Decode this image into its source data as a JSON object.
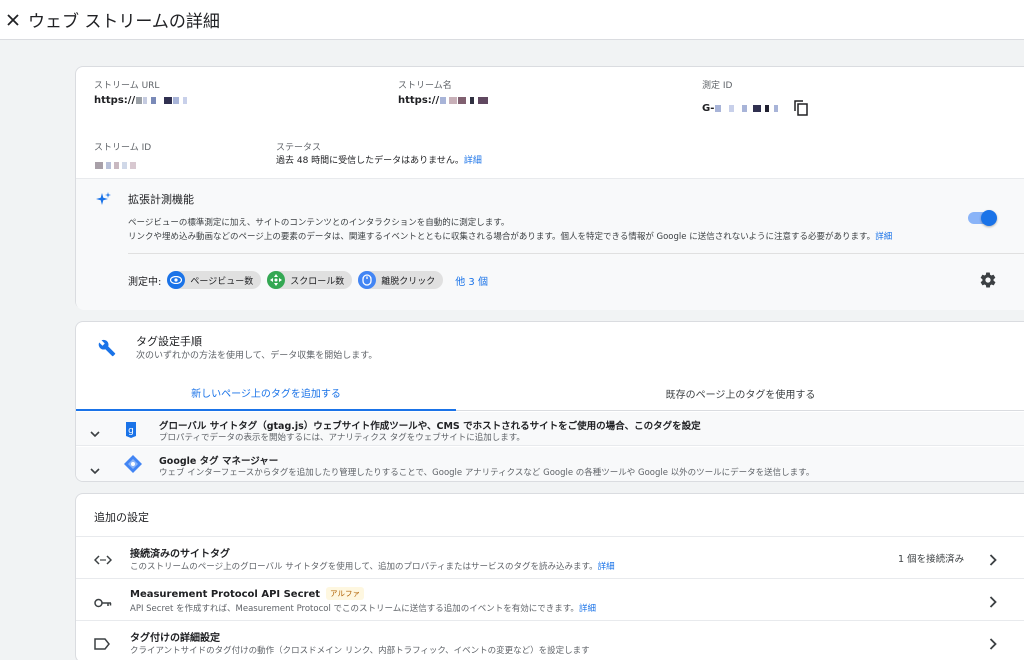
{
  "header": {
    "title": "ウェブ ストリームの詳細",
    "close_icon": "close-icon"
  },
  "stream": {
    "url_label": "ストリーム URL",
    "url_value": "https://",
    "name_label": "ストリーム名",
    "name_value": "https://",
    "measurement_label": "測定 ID",
    "measurement_value": "G-",
    "stream_id_label": "ストリーム ID",
    "status_label": "ステータス",
    "status_value": "過去 48 時間に受信したデータはありません。",
    "status_link": "詳細"
  },
  "enhanced": {
    "title": "拡張計測機能",
    "desc_line1": "ページビューの標準測定に加え、サイトのコンテンツとのインタラクションを自動的に測定します。",
    "desc_line2": "リンクや埋め込み動画などのページ上の要素のデータは、関連するイベントとともに収集される場合があります。個人を特定できる情報が Google に送信されないように注意する必要があります。",
    "desc_link": "詳細",
    "measuring_label": "測定中:",
    "chips": [
      {
        "label": "ページビュー数",
        "icon": "eye-icon",
        "color": "#1a73e8"
      },
      {
        "label": "スクロール数",
        "icon": "crosshair-icon",
        "color": "#34a853"
      },
      {
        "label": "離脱クリック",
        "icon": "mouse-icon",
        "color": "#4285f4"
      }
    ],
    "more": "他 3 個",
    "enabled": true
  },
  "tagging": {
    "title": "タグ設定手順",
    "subtitle": "次のいずれかの方法を使用して、データ収集を開始します。",
    "tabs": [
      "新しいページ上のタグを追加する",
      "既存のページ上のタグを使用する"
    ],
    "active_tab": 0,
    "rows": [
      {
        "title": "グローバル サイトタグ（gtag.js）ウェブサイト作成ツールや、CMS でホストされるサイトをご使用の場合、このタグを設定",
        "desc": "プロパティでデータの表示を開始するには、アナリティクス タグをウェブサイトに追加します。"
      },
      {
        "title": "Google タグ マネージャー",
        "desc": "ウェブ インターフェースからタグを追加したり管理したりすることで、Google アナリティクスなど Google の各種ツールや Google 以外のツールにデータを送信します。"
      }
    ]
  },
  "additional": {
    "title": "追加の設定",
    "rows": [
      {
        "title": "接続済みのサイトタグ",
        "desc": "このストリームのページ上のグローバル サイトタグを使用して、追加のプロパティまたはサービスのタグを読み込みます。",
        "link": "詳細",
        "status": "1 個を接続済み"
      },
      {
        "title": "Measurement Protocol API Secret",
        "badge": "アルファ",
        "desc": "API Secret を作成すれば、Measurement Protocol でこのストリームに送信する追加のイベントを有効にできます。",
        "link": "詳細"
      },
      {
        "title": "タグ付けの詳細設定",
        "desc": "クライアントサイドのタグ付けの動作（クロスドメイン リンク、内部トラフィック、イベントの変更など）を設定します"
      }
    ]
  },
  "colors": {
    "accent": "#1a73e8",
    "background": "#f1f3f4"
  }
}
